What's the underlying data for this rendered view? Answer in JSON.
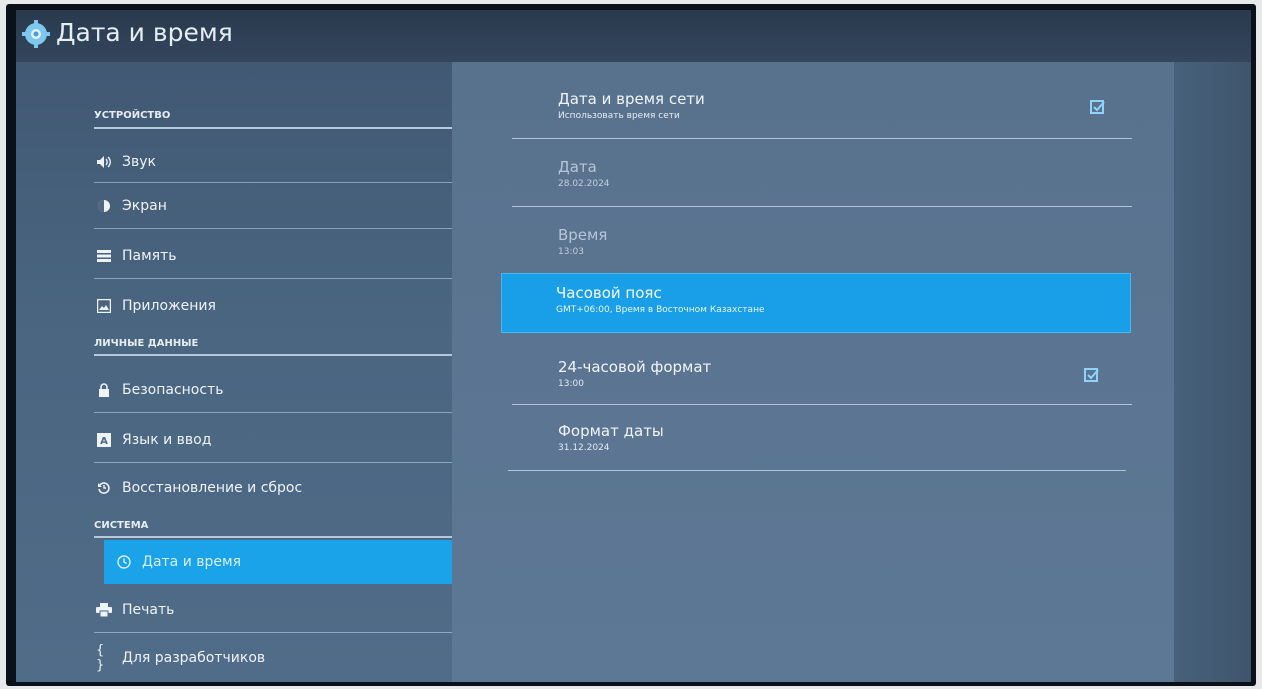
{
  "window": {
    "title": "Дата и время",
    "icon": "gear-icon"
  },
  "nav": {
    "sections": [
      {
        "header": "УСТРОЙСТВО"
      },
      {
        "header": "ЛИЧНЫЕ ДАННЫЕ"
      },
      {
        "header": "СИСТЕМА"
      }
    ],
    "items": [
      {
        "label": "Звук",
        "icon": "volume-icon"
      },
      {
        "label": "Экран",
        "icon": "display-icon"
      },
      {
        "label": "Память",
        "icon": "storage-icon"
      },
      {
        "label": "Приложения",
        "icon": "apps-icon"
      },
      {
        "label": "Безопасность",
        "icon": "lock-icon"
      },
      {
        "label": "Язык и ввод",
        "icon": "keyboard-icon"
      },
      {
        "label": "Восстановление и сброс",
        "icon": "restore-icon"
      },
      {
        "label": "Дата и время",
        "icon": "clock-icon",
        "selected": true
      },
      {
        "label": "Печать",
        "icon": "printer-icon"
      },
      {
        "label": "Для разработчиков",
        "icon": "braces-icon"
      }
    ]
  },
  "prefs": [
    {
      "title": "Дата и время сети",
      "summary": "Использовать время сети",
      "checked": true
    },
    {
      "title": "Дата",
      "summary": "28.02.2024",
      "disabled": true
    },
    {
      "title": "Время",
      "summary": "13:03",
      "disabled": true
    },
    {
      "title": "Часовой пояс",
      "summary": "GMT+06:00, Время в Восточном Казахстане",
      "selected": true
    },
    {
      "title": "24-часовой формат",
      "summary": "13:00",
      "checked": true
    },
    {
      "title": "Формат даты",
      "summary": "31.12.2024"
    }
  ],
  "colors": {
    "accent": "#1ba3ea",
    "checkbox": "#8fd3fb"
  }
}
